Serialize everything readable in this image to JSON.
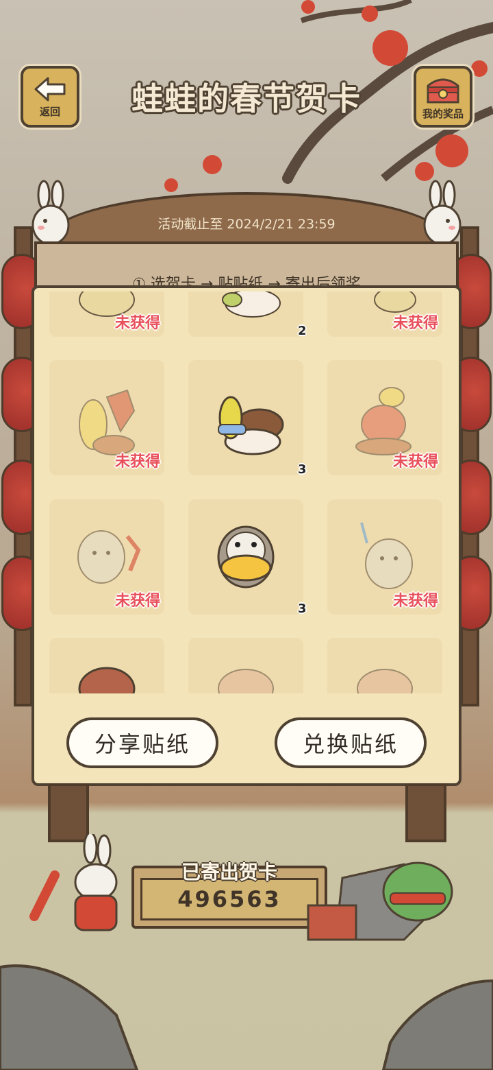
{
  "header": {
    "back_label": "返回",
    "title": "蛙蛙的春节贺卡",
    "prizes_label": "我的奖品"
  },
  "board": {
    "deadline": "活动截止至 2024/2/21 23:59",
    "steps": "① 选贺卡 → 贴贴纸 → 寄出后领奖"
  },
  "stickers": [
    {
      "status": "未获得",
      "count": ""
    },
    {
      "status": "",
      "count": "2"
    },
    {
      "status": "未获得",
      "count": ""
    },
    {
      "status": "未获得",
      "count": ""
    },
    {
      "status": "",
      "count": "3"
    },
    {
      "status": "未获得",
      "count": ""
    },
    {
      "status": "未获得",
      "count": ""
    },
    {
      "status": "",
      "count": "3"
    },
    {
      "status": "未获得",
      "count": ""
    },
    {
      "status": "",
      "count": ""
    },
    {
      "status": "",
      "count": ""
    },
    {
      "status": "",
      "count": ""
    }
  ],
  "actions": {
    "share_label": "分享贴纸",
    "exchange_label": "兑换贴纸"
  },
  "sent": {
    "title": "已寄出贺卡",
    "count": "496563"
  },
  "colors": {
    "not_obtained": "#e8505b",
    "panel_bg": "#f3e4b9",
    "wood": "#8e6a4b"
  }
}
